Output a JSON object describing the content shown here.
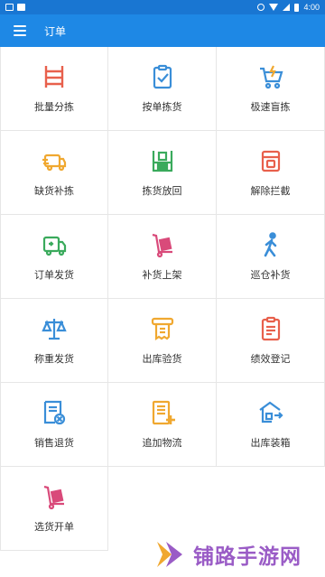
{
  "status_bar": {
    "time": "4:00"
  },
  "app_bar": {
    "title": "订单"
  },
  "tiles": [
    {
      "label": "批量分拣",
      "icon": "shelf-icon",
      "color": "#e8604c"
    },
    {
      "label": "按单拣货",
      "icon": "clipboard-check-icon",
      "color": "#3a8ed8"
    },
    {
      "label": "极速盲拣",
      "icon": "fast-cart-icon",
      "color": "#3a8ed8"
    },
    {
      "label": "缺货补拣",
      "icon": "truck-icon",
      "color": "#f0a830"
    },
    {
      "label": "拣货放回",
      "icon": "return-shelf-icon",
      "color": "#3aaa5c"
    },
    {
      "label": "解除拦截",
      "icon": "box-icon",
      "color": "#e8604c"
    },
    {
      "label": "订单发货",
      "icon": "delivery-truck-icon",
      "color": "#3aaa5c"
    },
    {
      "label": "补货上架",
      "icon": "hand-truck-icon",
      "color": "#d94a7a"
    },
    {
      "label": "巡仓补货",
      "icon": "walking-person-icon",
      "color": "#3a8ed8"
    },
    {
      "label": "称重发货",
      "icon": "scale-icon",
      "color": "#3a8ed8"
    },
    {
      "label": "出库验货",
      "icon": "receipt-icon",
      "color": "#f0a830"
    },
    {
      "label": "绩效登记",
      "icon": "register-clipboard-icon",
      "color": "#e8604c"
    },
    {
      "label": "销售退货",
      "icon": "document-cancel-icon",
      "color": "#3a8ed8"
    },
    {
      "label": "追加物流",
      "icon": "document-add-icon",
      "color": "#f0a830"
    },
    {
      "label": "出库装箱",
      "icon": "warehouse-icon",
      "color": "#3a8ed8"
    },
    {
      "label": "选货开单",
      "icon": "cart-box-icon",
      "color": "#d94a7a"
    }
  ],
  "watermark": {
    "text": "铺路手游网"
  }
}
